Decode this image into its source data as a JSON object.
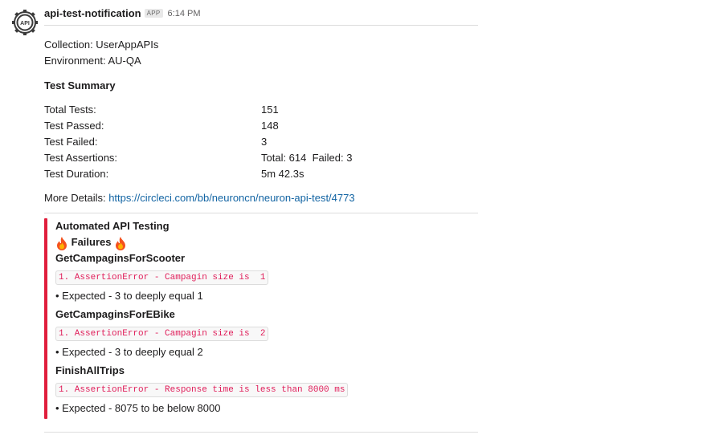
{
  "message": {
    "sender": "api-test-notification",
    "badge": "APP",
    "time": "6:14 PM",
    "avatar_label": "API",
    "collection": "Collection: UserAppAPIs",
    "environment": "Environment: AU-QA",
    "summary_title": "Test Summary",
    "summary": [
      {
        "label": "Total Tests:",
        "value": "151"
      },
      {
        "label": "Test Passed:",
        "value": "148"
      },
      {
        "label": "Test Failed:",
        "value": "3"
      },
      {
        "label": "Test Assertions:",
        "value": "Total: 614  Failed: 3"
      },
      {
        "label": "Test Duration:",
        "value": "5m 42.3s"
      }
    ],
    "details_label": "More Details:",
    "details_url": "https://circleci.com/bb/neuroncn/neuron-api-test/4773"
  },
  "attachment": {
    "accent_color": "#e01e3c",
    "title": "Automated API Testing",
    "failures_label": "Failures",
    "failures_icon": "fire-icon",
    "failures": [
      {
        "name": "GetCampaginsForScooter",
        "error": "1. AssertionError - Campagin size is  1",
        "detail": "• Expected - 3 to deeply equal 1"
      },
      {
        "name": "GetCampaginsForEBike",
        "error": "1. AssertionError - Campagin size is  2",
        "detail": "• Expected - 3 to deeply equal 2"
      },
      {
        "name": "FinishAllTrips",
        "error": "1. AssertionError - Response time is less than 8000 ms",
        "detail": "• Expected - 8075 to be below 8000"
      }
    ]
  }
}
